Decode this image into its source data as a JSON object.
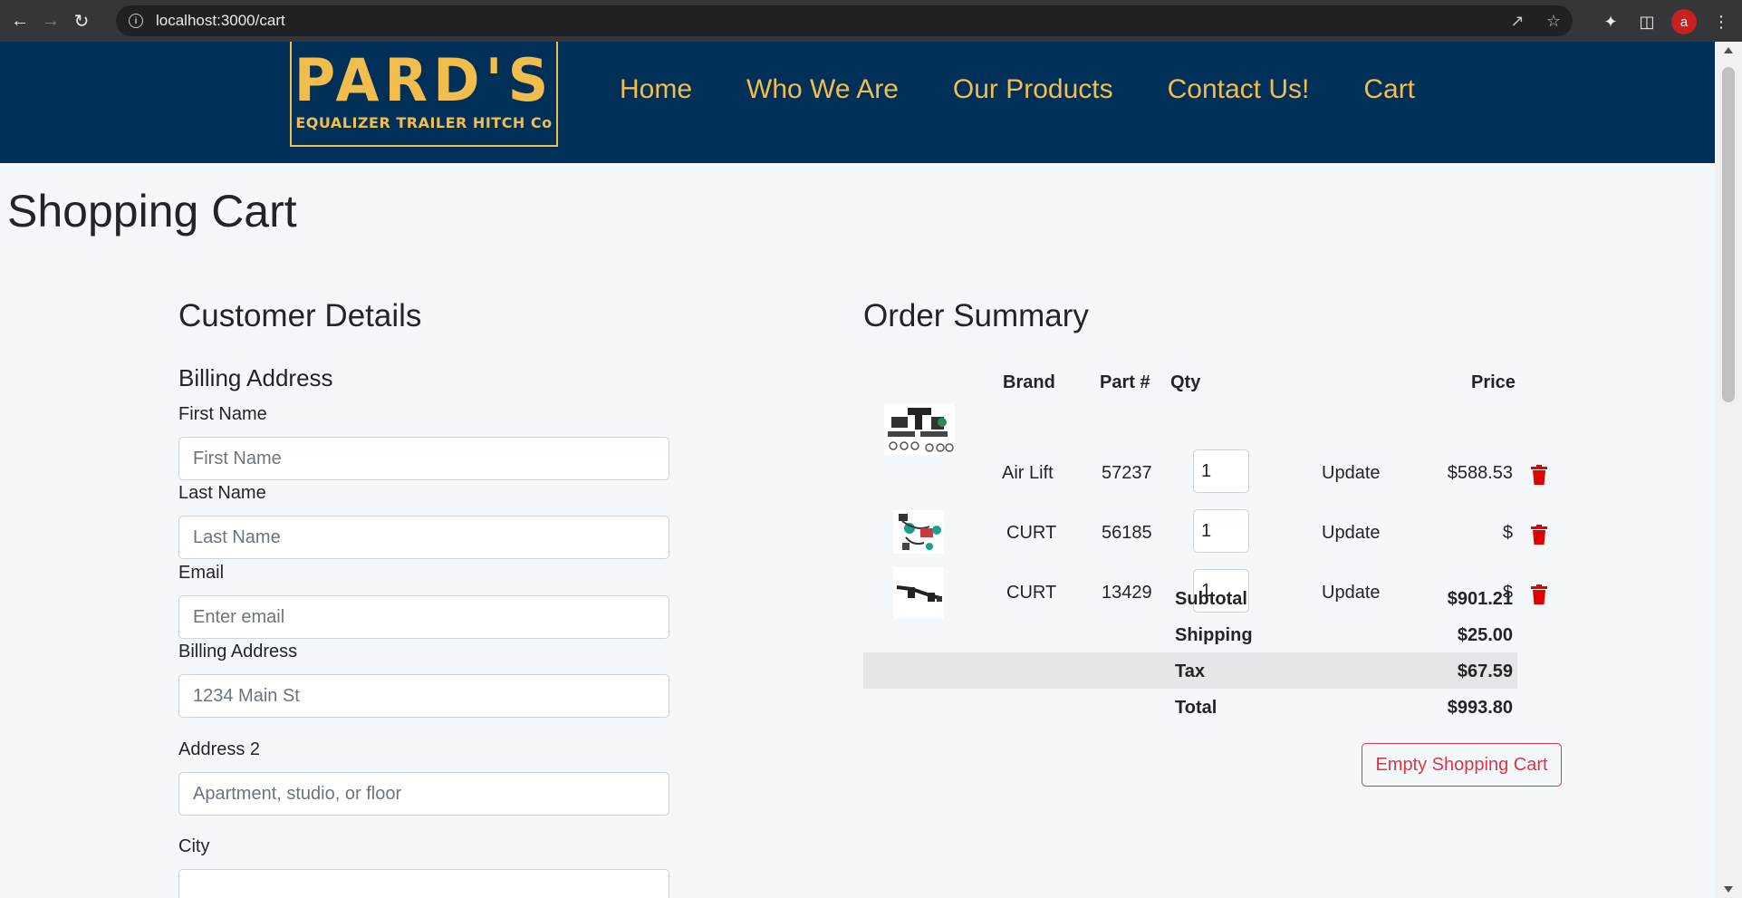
{
  "browser": {
    "url": "localhost:3000/cart",
    "avatar_letter": "a"
  },
  "navbar": {
    "logo_main": "PARD'S",
    "logo_sub": "EQUALIZER TRAILER HITCH Co",
    "links": [
      "Home",
      "Who We Are",
      "Our Products",
      "Contact Us!",
      "Cart"
    ]
  },
  "page": {
    "title": "Shopping Cart"
  },
  "customer": {
    "heading": "Customer Details",
    "subheading": "Billing Address",
    "fields": {
      "first_name": {
        "label": "First Name",
        "placeholder": "First Name",
        "value": ""
      },
      "last_name": {
        "label": "Last Name",
        "placeholder": "Last Name",
        "value": ""
      },
      "email": {
        "label": "Email",
        "placeholder": "Enter email",
        "value": ""
      },
      "address": {
        "label": "Billing Address",
        "placeholder": "1234 Main St",
        "value": ""
      },
      "address2": {
        "label": "Address 2",
        "placeholder": "Apartment, studio, or floor",
        "value": ""
      },
      "city": {
        "label": "City",
        "placeholder": "",
        "value": ""
      }
    }
  },
  "order": {
    "heading": "Order Summary",
    "columns": {
      "brand": "Brand",
      "part": "Part #",
      "qty": "Qty",
      "price": "Price"
    },
    "items": [
      {
        "brand": "Air Lift",
        "part": "57237",
        "qty": "1",
        "update": "Update",
        "price": "$588.53"
      },
      {
        "brand": "CURT",
        "part": "56185",
        "qty": "1",
        "update": "Update",
        "price": "$"
      },
      {
        "brand": "CURT",
        "part": "13429",
        "qty": "1",
        "update": "Update",
        "price": "$"
      }
    ],
    "summary": {
      "subtotal_label": "Subtotal",
      "subtotal": "$901.21",
      "shipping_label": "Shipping",
      "shipping": "$25.00",
      "tax_label": "Tax",
      "tax": "$67.59",
      "total_label": "Total",
      "total": "$993.80"
    },
    "empty_button": "Empty Shopping Cart"
  },
  "colors": {
    "navbar_bg": "#003057",
    "accent_gold": "#f2bd4d",
    "danger": "#dc3545",
    "trash_red": "#e00000"
  }
}
